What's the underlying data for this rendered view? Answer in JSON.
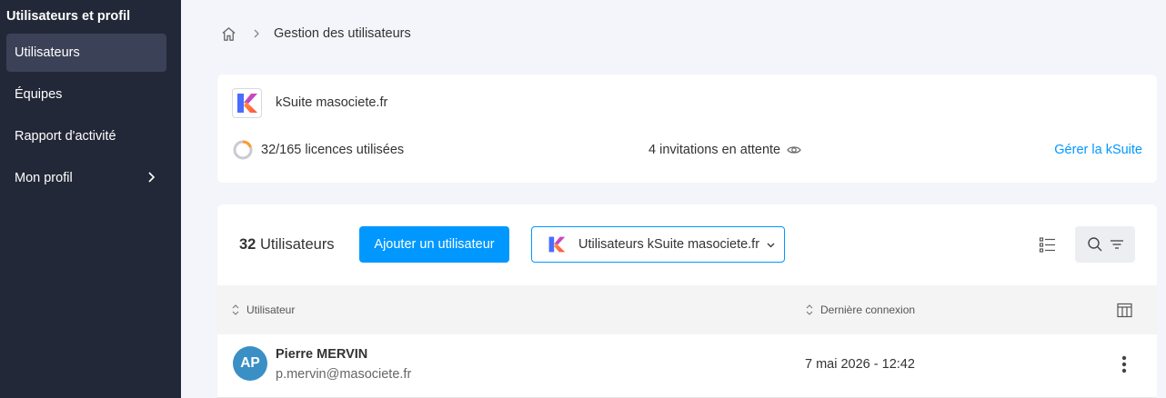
{
  "sidebar": {
    "title": "Utilisateurs et profil",
    "items": [
      {
        "label": "Utilisateurs",
        "active": true
      },
      {
        "label": "Équipes"
      },
      {
        "label": "Rapport d'activité"
      },
      {
        "label": "Mon profil",
        "icon": "chevron-right-icon"
      }
    ]
  },
  "breadcrumb": {
    "home_icon": "home-icon",
    "current": "Gestion des utilisateurs"
  },
  "ksuite": {
    "name": "kSuite masociete.fr",
    "licences_used": 32,
    "licences_total": 165,
    "licences_text": "32/165 licences utilisées",
    "invitations_text": "4 invitations en attente",
    "manage_link": "Gérer la kSuite"
  },
  "users_panel": {
    "count": "32",
    "count_label": "Utilisateurs",
    "add_button": "Ajouter un utilisateur",
    "filter_selected": "Utilisateurs kSuite masociete.fr",
    "columns": {
      "user": "Utilisateur",
      "last_login": "Dernière connexion"
    },
    "rows": [
      {
        "initials": "AP",
        "name": "Pierre MERVIN",
        "email": "p.mervin@masociete.fr",
        "last_login": "7 mai 2026 - 12:42"
      }
    ]
  },
  "colors": {
    "sidebar_bg": "#232838",
    "sidebar_active": "#3b4156",
    "accent": "#0098ff",
    "avatar": "#3a8fc5",
    "licence_ring": "#ff9a2e"
  }
}
